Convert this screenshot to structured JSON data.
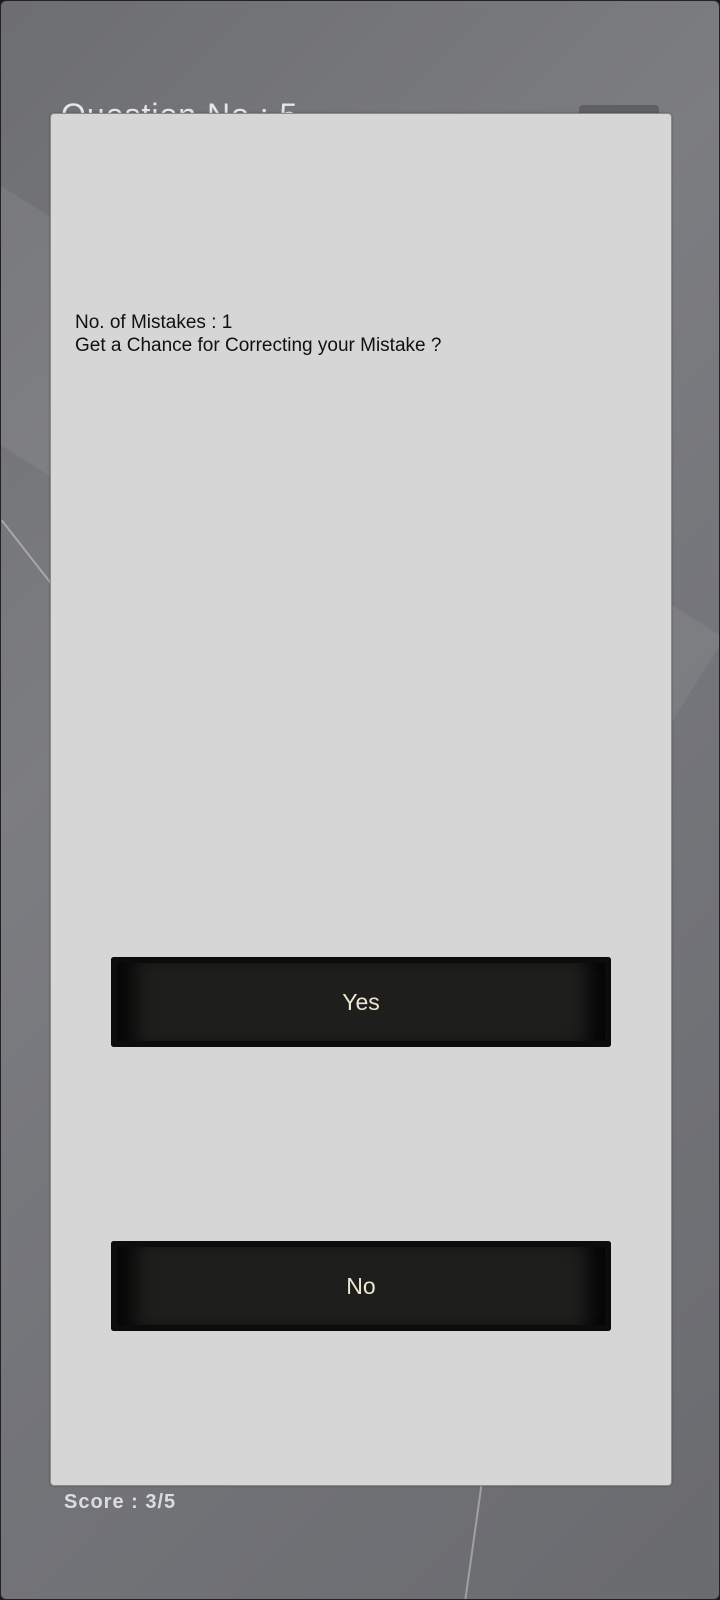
{
  "quiz": {
    "question_title": "Question No : 5",
    "score_text": "Score : 3/5"
  },
  "dialog": {
    "mistakes_line": "No. of Mistakes : 1",
    "prompt_line": "Get a Chance for Correcting your Mistake ?",
    "yes_label": "Yes",
    "no_label": "No"
  },
  "colors": {
    "dialog_bg": "#d6d6d6",
    "button_bg": "#1e1f1d",
    "button_text": "#ece6d2",
    "page_bg": "#76777b"
  }
}
